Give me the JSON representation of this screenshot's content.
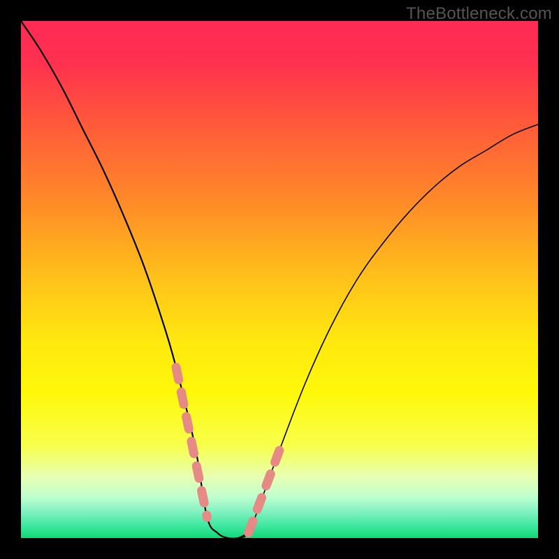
{
  "watermark": "TheBottleneck.com",
  "colors": {
    "background": "#000000",
    "gradient_stops": [
      {
        "offset": 0.0,
        "color": "#ff2a55"
      },
      {
        "offset": 0.08,
        "color": "#ff3050"
      },
      {
        "offset": 0.2,
        "color": "#ff5a3a"
      },
      {
        "offset": 0.35,
        "color": "#ff8a28"
      },
      {
        "offset": 0.5,
        "color": "#ffc21a"
      },
      {
        "offset": 0.62,
        "color": "#ffe80f"
      },
      {
        "offset": 0.72,
        "color": "#fff80a"
      },
      {
        "offset": 0.82,
        "color": "#f8ff4a"
      },
      {
        "offset": 0.88,
        "color": "#e8ffb0"
      },
      {
        "offset": 0.92,
        "color": "#c0ffd0"
      },
      {
        "offset": 0.95,
        "color": "#80f0c0"
      },
      {
        "offset": 0.975,
        "color": "#40e8a0"
      },
      {
        "offset": 1.0,
        "color": "#10d878"
      }
    ],
    "curve": "#000000",
    "dash_color": "#e58a84",
    "dash_width": 13
  },
  "chart_data": {
    "type": "line",
    "title": "",
    "xlabel": "",
    "ylabel": "",
    "xlim": [
      0,
      100
    ],
    "ylim": [
      0,
      100
    ],
    "notes": "V-shaped bottleneck curve. x is normalized horizontal position (0-100), y is normalized mismatch/penalty (0 best, 100 worst). Minimum plateau around x=36..44.",
    "series": [
      {
        "name": "bottleneck_curve",
        "x": [
          0,
          4,
          8,
          12,
          16,
          20,
          24,
          28,
          30,
          32,
          34,
          36,
          38,
          40,
          42,
          44,
          46,
          50,
          55,
          60,
          65,
          70,
          75,
          80,
          85,
          90,
          95,
          100
        ],
        "y": [
          100,
          94,
          87,
          79,
          71,
          62,
          52,
          40,
          33,
          25,
          16,
          4,
          1,
          0,
          0,
          1,
          6,
          17,
          30,
          41,
          50,
          57,
          63,
          68,
          72,
          75,
          78,
          80
        ]
      }
    ],
    "highlight_dashes": {
      "left": {
        "x_range": [
          30,
          36
        ],
        "y_range": [
          33,
          4
        ]
      },
      "right": {
        "x_range": [
          44,
          50
        ],
        "y_range": [
          1,
          17
        ]
      }
    }
  }
}
